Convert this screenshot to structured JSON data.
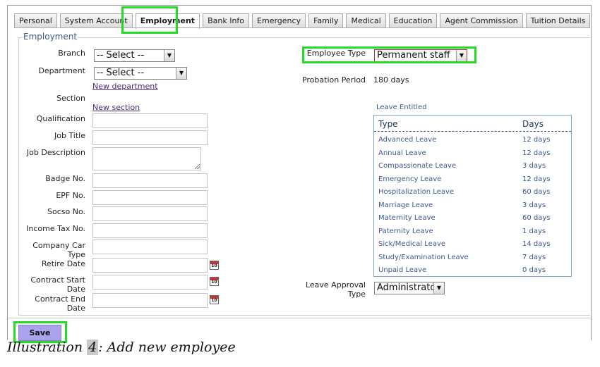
{
  "tabs": [
    {
      "label": "Personal"
    },
    {
      "label": "System Account"
    },
    {
      "label": "Employment"
    },
    {
      "label": "Bank Info"
    },
    {
      "label": "Emergency"
    },
    {
      "label": "Family"
    },
    {
      "label": "Medical"
    },
    {
      "label": "Education"
    },
    {
      "label": "Agent Commission"
    },
    {
      "label": "Tuition Details"
    }
  ],
  "active_tab": "Employment",
  "section_title": "Employment",
  "form": {
    "branch": {
      "label": "Branch",
      "value": "-- Select --"
    },
    "department": {
      "label": "Department",
      "value": "-- Select --",
      "link": "New department"
    },
    "section": {
      "label": "Section",
      "link": "New section"
    },
    "qualification": {
      "label": "Qualification",
      "value": ""
    },
    "job_title": {
      "label": "Job Title",
      "value": ""
    },
    "job_description": {
      "label": "Job Description",
      "value": ""
    },
    "badge_no": {
      "label": "Badge No.",
      "value": ""
    },
    "epf_no": {
      "label": "EPF No.",
      "value": ""
    },
    "socso_no": {
      "label": "Socso No.",
      "value": ""
    },
    "income_tax_no": {
      "label": "Income Tax No.",
      "value": ""
    },
    "company_car_type": {
      "label_1": "Company Car",
      "label_2": "Type",
      "value": ""
    },
    "retire_date": {
      "label": "Retire Date",
      "value": ""
    },
    "contract_start_date": {
      "label_1": "Contract Start",
      "label_2": "Date",
      "value": ""
    },
    "contract_end_date": {
      "label": "Contract End Date",
      "value": ""
    }
  },
  "calendar_icon_text": "10",
  "right": {
    "employee_type": {
      "label": "Employee Type",
      "value": "Permanent staff"
    },
    "probation_period": {
      "label": "Probation Period",
      "value": "180 days"
    },
    "leave_entitled": {
      "title": "Leave Entitled",
      "col_type": "Type",
      "col_days": "Days",
      "rows": [
        {
          "type": "Advanced Leave",
          "days": "12 days"
        },
        {
          "type": "Annual Leave",
          "days": "12 days"
        },
        {
          "type": "Compassionate Leave",
          "days": "3 days"
        },
        {
          "type": "Emergency Leave",
          "days": "12 days"
        },
        {
          "type": "Hospitalization Leave",
          "days": "60 days"
        },
        {
          "type": "Marriage Leave",
          "days": "3 days"
        },
        {
          "type": "Maternity Leave",
          "days": "60 days"
        },
        {
          "type": "Paternity Leave",
          "days": "1 days"
        },
        {
          "type": "Sick/Medical Leave",
          "days": "14 days"
        },
        {
          "type": "Study/Examination Leave",
          "days": "7 days"
        },
        {
          "type": "Unpaid Leave",
          "days": "0 days"
        }
      ]
    },
    "leave_approval_type": {
      "label_1": "Leave Approval",
      "label_2": "Type",
      "value": "Administrator"
    }
  },
  "save_label": "Save",
  "caption": {
    "prefix": "Illustration ",
    "number": "4",
    "suffix": ": Add new employee"
  },
  "colors": {
    "highlight": "#22dd22",
    "save_button": "#a9a3ee",
    "link": "#4a2a7a",
    "leave_text": "#3b5a8a"
  }
}
